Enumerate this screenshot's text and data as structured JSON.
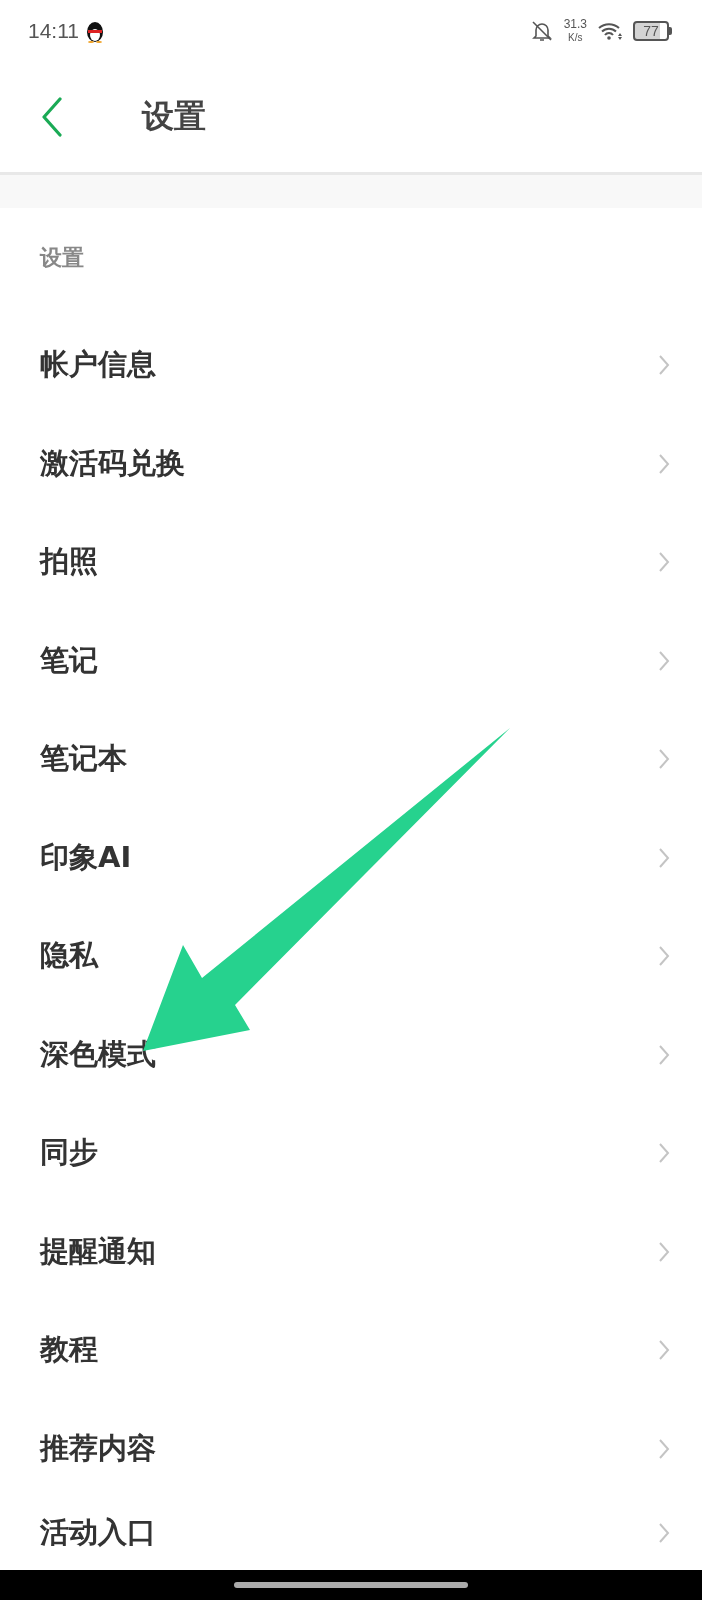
{
  "status_bar": {
    "time": "14:11",
    "net_speed": "31.3",
    "net_speed_unit": "K/s",
    "battery": "77"
  },
  "header": {
    "title": "设置"
  },
  "section": {
    "label": "设置"
  },
  "items": [
    {
      "label": "帐户信息"
    },
    {
      "label": "激活码兑换"
    },
    {
      "label": "拍照"
    },
    {
      "label": "笔记"
    },
    {
      "label": "笔记本"
    },
    {
      "label": "印象AI"
    },
    {
      "label": "隐私"
    },
    {
      "label": "深色模式"
    },
    {
      "label": "同步"
    },
    {
      "label": "提醒通知"
    },
    {
      "label": "教程"
    },
    {
      "label": "推荐内容"
    },
    {
      "label": "活动入口"
    }
  ]
}
